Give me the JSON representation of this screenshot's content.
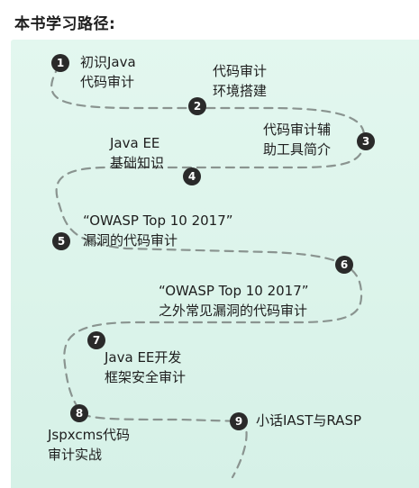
{
  "heading": "本书学习路径:",
  "steps": [
    {
      "badge": "1",
      "line1": "初识Java",
      "line2": "代码审计"
    },
    {
      "badge": "2",
      "line1": "代码审计",
      "line2": "环境搭建"
    },
    {
      "badge": "3",
      "line1": "代码审计辅",
      "line2": "助工具简介"
    },
    {
      "badge": "4",
      "line1": "Java EE",
      "line2": "基础知识"
    },
    {
      "badge": "5",
      "line1": "“OWASP Top 10 2017”",
      "line2": "漏洞的代码审计"
    },
    {
      "badge": "6",
      "line1": "“OWASP Top 10 2017”",
      "line2": "之外常见漏洞的代码审计"
    },
    {
      "badge": "7",
      "line1": "Java EE开发",
      "line2": "框架安全审计"
    },
    {
      "badge": "8",
      "line1": "Jspxcms代码",
      "line2": "审计实战"
    },
    {
      "badge": "9",
      "line1": "小话IAST与RASP",
      "line2": ""
    }
  ],
  "colors": {
    "panel": "#dff5ec",
    "route": "#8a9490",
    "badge": "#2a2a2a",
    "text": "#1e1e1e"
  }
}
